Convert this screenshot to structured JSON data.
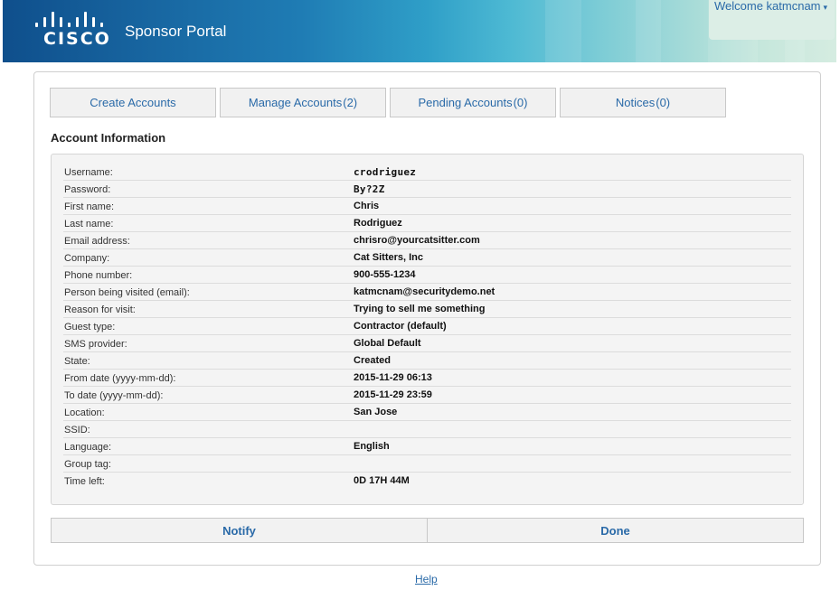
{
  "header": {
    "logo_text": "CISCO",
    "portal_title": "Sponsor Portal",
    "welcome": "Welcome katmcnam",
    "welcome_caret": "▾"
  },
  "tabs": [
    {
      "label": "Create Accounts",
      "count": ""
    },
    {
      "label": "Manage Accounts",
      "count": "(2)"
    },
    {
      "label": "Pending Accounts",
      "count": "(0)"
    },
    {
      "label": "Notices",
      "count": "(0)"
    }
  ],
  "section_title": "Account Information",
  "account_info": [
    {
      "label": "Username:",
      "value": "crodriguez"
    },
    {
      "label": "Password:",
      "value": "By?2Z"
    },
    {
      "label": "First name:",
      "value": "Chris"
    },
    {
      "label": "Last name:",
      "value": "Rodriguez"
    },
    {
      "label": "Email address:",
      "value": "chrisro@yourcatsitter.com"
    },
    {
      "label": "Company:",
      "value": "Cat Sitters, Inc"
    },
    {
      "label": "Phone number:",
      "value": "900-555-1234"
    },
    {
      "label": "Person being visited (email):",
      "value": "katmcnam@securitydemo.net"
    },
    {
      "label": "Reason for visit:",
      "value": "Trying to sell me something"
    },
    {
      "label": "Guest type:",
      "value": "Contractor (default)"
    },
    {
      "label": "SMS provider:",
      "value": "Global Default"
    },
    {
      "label": "State:",
      "value": "Created"
    },
    {
      "label": "From date (yyyy-mm-dd):",
      "value": "2015-11-29 06:13"
    },
    {
      "label": "To date (yyyy-mm-dd):",
      "value": "2015-11-29 23:59"
    },
    {
      "label": "Location:",
      "value": "San Jose"
    },
    {
      "label": "SSID:",
      "value": ""
    },
    {
      "label": "Language:",
      "value": "English"
    },
    {
      "label": "Group tag:",
      "value": ""
    },
    {
      "label": "Time left:",
      "value": "0D 17H 44M"
    }
  ],
  "buttons": {
    "notify": "Notify",
    "done": "Done"
  },
  "footer": {
    "help": "Help"
  },
  "colors": {
    "link": "#2a6aa8",
    "header_dark": "#0f4f8c",
    "header_light": "#d5ece1"
  }
}
